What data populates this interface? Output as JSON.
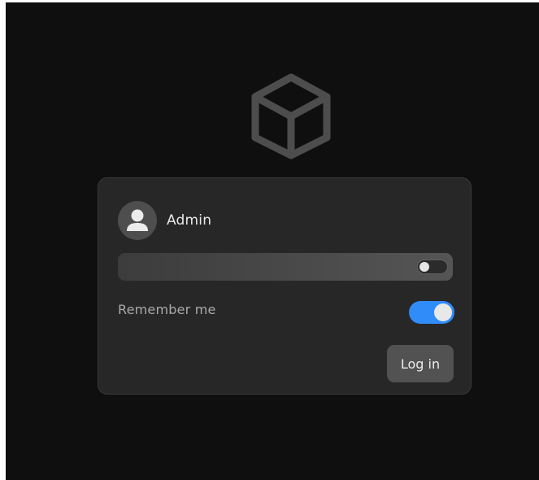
{
  "app": {
    "logo_icon": "cube-icon"
  },
  "login": {
    "username": "Admin",
    "avatar_icon": "user-avatar-icon",
    "password": {
      "value": "",
      "placeholder": "",
      "reveal_toggle_on": false
    },
    "remember_me": {
      "label": "Remember me",
      "checked": true
    },
    "submit_label": "Log in"
  },
  "colors": {
    "background": "#0f0f0f",
    "card": "#272727",
    "accent": "#2f8cf8",
    "button": "#525252"
  }
}
